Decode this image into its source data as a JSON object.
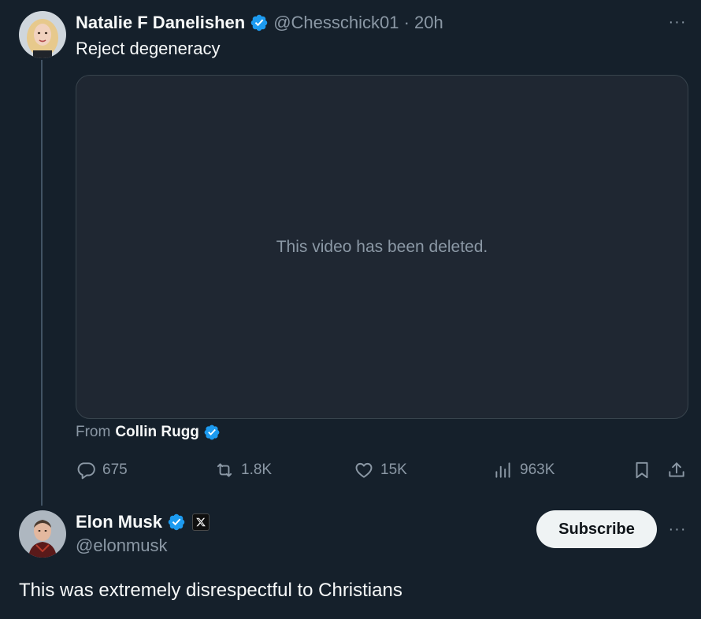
{
  "quoted_tweet": {
    "author_name": "Natalie F Danelishen",
    "handle_time": "@Chesschick01 · 20h",
    "text": "Reject degeneracy",
    "media_message": "This video has been deleted.",
    "from_label": "From",
    "from_name": "Collin Rugg",
    "stats": {
      "replies": "675",
      "reposts": "1.8K",
      "likes": "15K",
      "views": "963K"
    }
  },
  "reply": {
    "author_name": "Elon Musk",
    "handle": "@elonmusk",
    "subscribe_label": "Subscribe",
    "text": "This was extremely disrespectful to Christians"
  },
  "more_label": "···",
  "colors": {
    "background": "#15202b",
    "verified": "#1d9bf0",
    "muted": "#8b98a5",
    "text": "#f7f9f9"
  }
}
